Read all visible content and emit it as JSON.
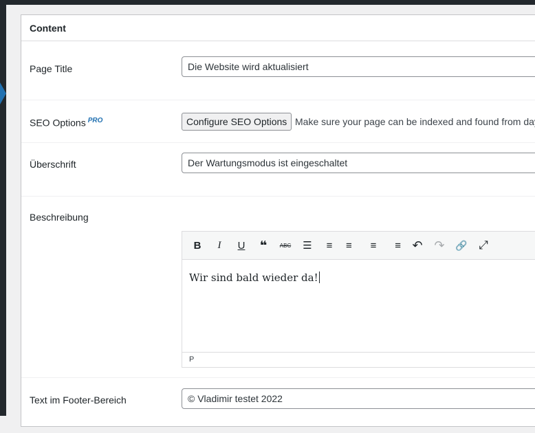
{
  "section": {
    "title": "Content"
  },
  "fields": {
    "page_title": {
      "label": "Page Title",
      "value": "Die Website wird aktualisiert"
    },
    "seo": {
      "label": "SEO Options",
      "badge": "PRO",
      "button": "Configure SEO Options",
      "hint": "Make sure your page can be indexed and found from day"
    },
    "heading": {
      "label": "Überschrift",
      "value": "Der Wartungsmodus ist eingeschaltet"
    },
    "description": {
      "label": "Beschreibung",
      "content": "Wir sind bald wieder da!",
      "status_path": "P"
    },
    "footer": {
      "label": "Text im Footer-Bereich",
      "value": "© Vladimir testet 2022"
    }
  },
  "toolbar": {
    "bold": "B",
    "italic": "I",
    "underline": "U",
    "quote": "❝",
    "strikethrough": "ABC",
    "bullet_list": "☰",
    "numbered_list": "≡",
    "align_left": "≡",
    "align_center": "≡",
    "align_right": "≡",
    "undo": "↶",
    "redo": "↷",
    "link": "🔗",
    "fullscreen": "⤢"
  }
}
